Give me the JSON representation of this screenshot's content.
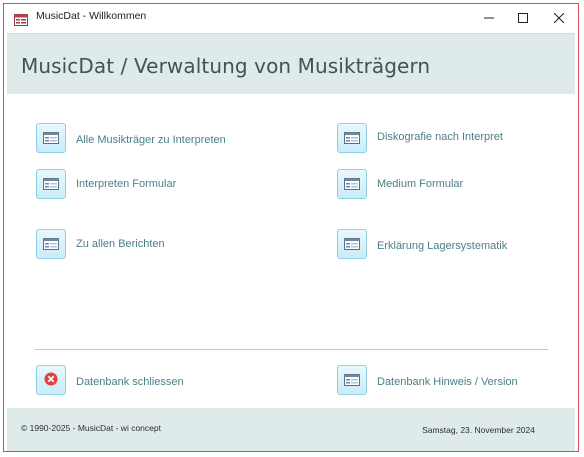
{
  "window": {
    "title": "MusicDat - Willkommen",
    "controls": {
      "minimize": "minimize-icon",
      "maximize": "maximize-icon",
      "close": "close-icon"
    }
  },
  "header": {
    "title": "MusicDat / Verwaltung von Musikträgern"
  },
  "menu": {
    "left": [
      {
        "label": "Alle Musikträger zu Interpreten",
        "icon": "form-icon"
      },
      {
        "label": "Interpreten Formular",
        "icon": "form-icon"
      },
      {
        "label": "Zu allen Berichten",
        "icon": "form-icon"
      }
    ],
    "right": [
      {
        "label": "Diskografie nach Interpret",
        "icon": "form-icon"
      },
      {
        "label": "Medium Formular",
        "icon": "form-icon"
      },
      {
        "label": "Erklärung Lagersystematik",
        "icon": "form-icon"
      }
    ]
  },
  "bottom_actions": {
    "close_db": {
      "label": "Datenbank schliessen",
      "icon": "close-circle-icon"
    },
    "info": {
      "label": "Datenbank Hinweis / Version",
      "icon": "form-icon"
    }
  },
  "footer": {
    "copyright": "© 1990-2025 - MusicDat - wi concept",
    "date": "Samstag, 23. November 2024"
  },
  "colors": {
    "accent_border": "#d14b55",
    "header_bg": "#dfeaea",
    "label": "#4b7f86",
    "button_border": "#8fcfe3"
  }
}
